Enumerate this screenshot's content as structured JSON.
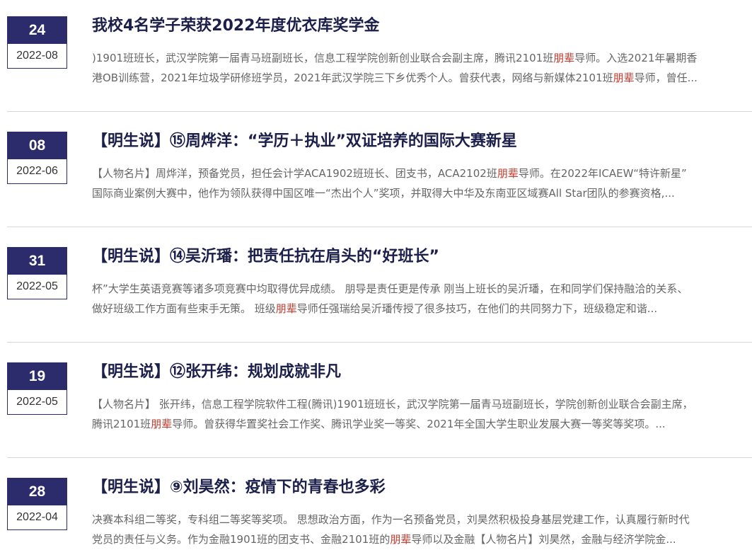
{
  "theme": {
    "accent": "#2c2b6c",
    "title_color": "#1b1f4a",
    "highlight": "#c0392b"
  },
  "items": [
    {
      "day": "24",
      "year_month": "2022-08",
      "title": "我校4名学子荣获2022年度优衣库奖学金",
      "line1_a": ")1901班班长，武汉学院第一届青马班副班长，信息工程学院创新创业联合会副主席，腾讯2101班",
      "line1_hl": "朋辈",
      "line1_b": "导师。入选2021年暑期香",
      "line2_a": "港OB训练营，2021年垃圾学研修班学员，2021年武汉学院三下乡优秀个人。曾获代表，网络与新媒体2101班",
      "line2_hl": "朋辈",
      "line2_b": "导师，曾任..."
    },
    {
      "day": "08",
      "year_month": "2022-06",
      "title": "【明生说】⑮周烨洋：“学历＋执业”双证培养的国际大赛新星",
      "line1_a": "【人物名片】周烨洋，预备党员，担任会计学ACA1902班班长、团支书，ACA2102班",
      "line1_hl": "朋辈",
      "line1_b": "导师。在2022年ICAEW“特许新星”",
      "line2_a": "国际商业案例大赛中，他作为领队获得中国区唯一“杰出个人”奖项，并取得大中华及东南亚区域赛All Star团队的参赛资格,...",
      "line2_hl": "",
      "line2_b": ""
    },
    {
      "day": "31",
      "year_month": "2022-05",
      "title": "【明生说】⑭吴沂璠：把责任抗在肩头的“好班长”",
      "line1_a": "杯”大学生英语竞赛等诸多项竞赛中均取得优异成绩。 朋导是责任更是传承 刚当上班长的吴沂璠，在和同学们保持融洽的关系、",
      "line1_hl": "",
      "line1_b": "",
      "line2_a": "做好班级工作方面有些束手无策。 班级",
      "line2_hl": "朋辈",
      "line2_b": "导师任强瑞给吴沂璠传授了很多技巧，在他们的共同努力下，班级稳定和谐..."
    },
    {
      "day": "19",
      "year_month": "2022-05",
      "title": "【明生说】⑫张开纬：规划成就非凡",
      "line1_a": "【人物名片】 张开纬，信息工程学院软件工程(腾讯)1901班班长，武汉学院第一届青马班副班长，学院创新创业联合会副主席，",
      "line1_hl": "",
      "line1_b": "",
      "line2_a": "腾讯2101班",
      "line2_hl": "朋辈",
      "line2_b": "导师。曾获得华置奖社会工作奖、腾讯学业奖一等奖、2021年全国大学生职业发展大赛一等奖等奖项。..."
    },
    {
      "day": "28",
      "year_month": "2022-04",
      "title": "【明生说】⑨刘昊然：疫情下的青春也多彩",
      "line1_a": "决赛本科组二等奖，专科组二等奖等奖项。 思想政治方面，作为一名预备党员，刘昊然积极投身基层党建工作，认真履行新时代",
      "line1_hl": "",
      "line1_b": "",
      "line2_a": "党员的责任与义务。作为金融1901班的团支书、金融2101班的",
      "line2_hl": "朋辈",
      "line2_b": "导师以及金融【人物名片】刘昊然，金融与经济学院金..."
    }
  ]
}
